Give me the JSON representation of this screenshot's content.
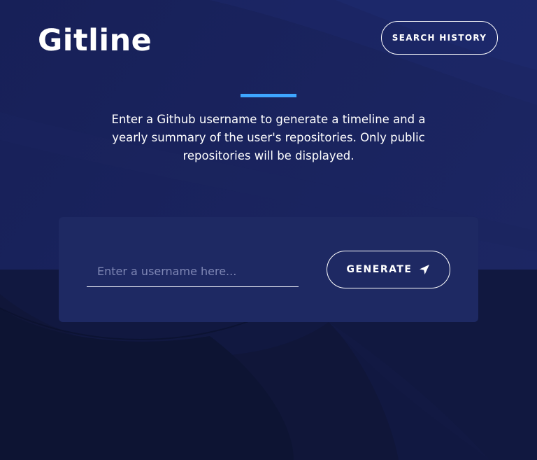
{
  "header": {
    "logo_text": "Gitline",
    "history_button_label": "SEARCH HISTORY"
  },
  "intro": {
    "text": "Enter a Github username to generate a timeline and a yearly summary of the user's repositories. Only public repositories will be displayed."
  },
  "form": {
    "username_placeholder": "Enter a username here...",
    "username_value": "",
    "generate_label": "GENERATE",
    "generate_icon": "paper-plane-icon"
  },
  "colors": {
    "background": "#121a45",
    "card": "#1e2963",
    "accent": "#3ea6ff"
  }
}
